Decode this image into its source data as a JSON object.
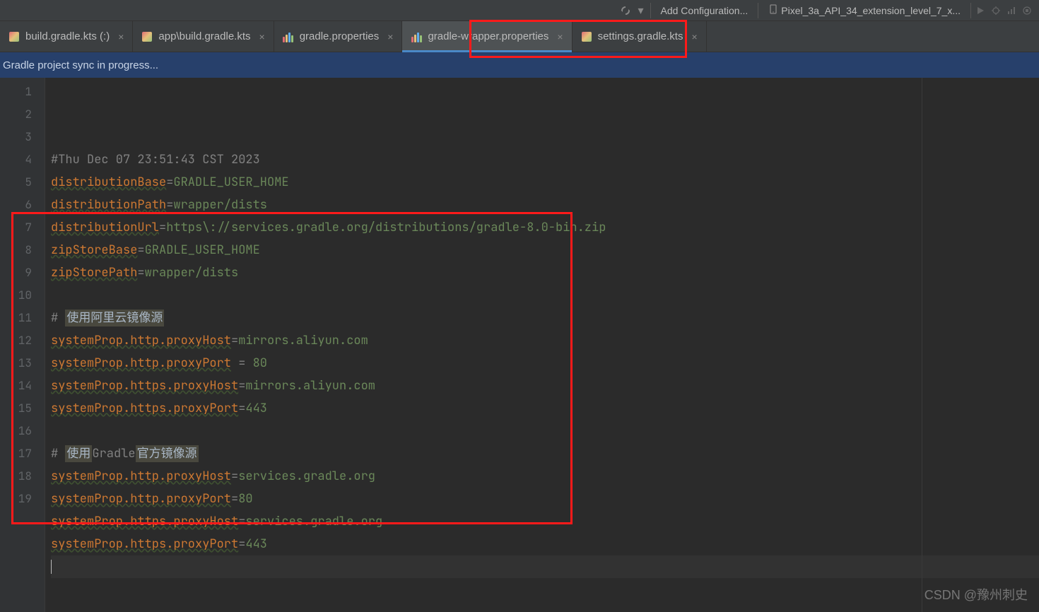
{
  "toolbar": {
    "add_config": "Add Configuration...",
    "device": "Pixel_3a_API_34_extension_level_7_x..."
  },
  "tabs": [
    {
      "label": "build.gradle.kts (:)",
      "icon": "gradle"
    },
    {
      "label": "app\\build.gradle.kts",
      "icon": "gradle"
    },
    {
      "label": "gradle.properties",
      "icon": "props"
    },
    {
      "label": "gradle-wrapper.properties",
      "icon": "props",
      "active": true
    },
    {
      "label": "settings.gradle.kts",
      "icon": "gradle"
    }
  ],
  "sync_message": "Gradle project sync in progress...",
  "code": {
    "lines": [
      {
        "n": 1,
        "type": "comment",
        "text": "#Thu Dec 07 23:51:43 CST 2023"
      },
      {
        "n": 2,
        "type": "kv",
        "key": "distributionBase",
        "val": "GRADLE_USER_HOME"
      },
      {
        "n": 3,
        "type": "kv",
        "key": "distributionPath",
        "val": "wrapper/dists"
      },
      {
        "n": 4,
        "type": "kv",
        "key": "distributionUrl",
        "val": "https\\://services.gradle.org/distributions/gradle-8.0-bin.zip"
      },
      {
        "n": 5,
        "type": "kv",
        "key": "zipStoreBase",
        "val": "GRADLE_USER_HOME"
      },
      {
        "n": 6,
        "type": "kv",
        "key": "zipStorePath",
        "val": "wrapper/dists"
      },
      {
        "n": 7,
        "type": "blank"
      },
      {
        "n": 8,
        "type": "comment-hl",
        "prefix": "# ",
        "hl": "使用阿里云镜像源"
      },
      {
        "n": 9,
        "type": "kv",
        "key": "systemProp.http.proxyHost",
        "val": "mirrors.aliyun.com"
      },
      {
        "n": 10,
        "type": "kv-sp",
        "key": "systemProp.http.proxyPort",
        "val": "80"
      },
      {
        "n": 11,
        "type": "kv",
        "key": "systemProp.https.proxyHost",
        "val": "mirrors.aliyun.com"
      },
      {
        "n": 12,
        "type": "kv",
        "key": "systemProp.https.proxyPort",
        "val": "443"
      },
      {
        "n": 13,
        "type": "blank"
      },
      {
        "n": 14,
        "type": "comment-hl2",
        "prefix": "# ",
        "hl1": "使用",
        "mid": "Gradle",
        "hl2": "官方镜像源"
      },
      {
        "n": 15,
        "type": "kv",
        "key": "systemProp.http.proxyHost",
        "val": "services.gradle.org"
      },
      {
        "n": 16,
        "type": "kv",
        "key": "systemProp.http.proxyPort",
        "val": "80"
      },
      {
        "n": 17,
        "type": "kv",
        "key": "systemProp.https.proxyHost",
        "val": "services.gradle.org"
      },
      {
        "n": 18,
        "type": "kv",
        "key": "systemProp.https.proxyPort",
        "val": "443"
      },
      {
        "n": 19,
        "type": "cursor"
      }
    ]
  },
  "watermark": "CSDN @豫州刺史"
}
